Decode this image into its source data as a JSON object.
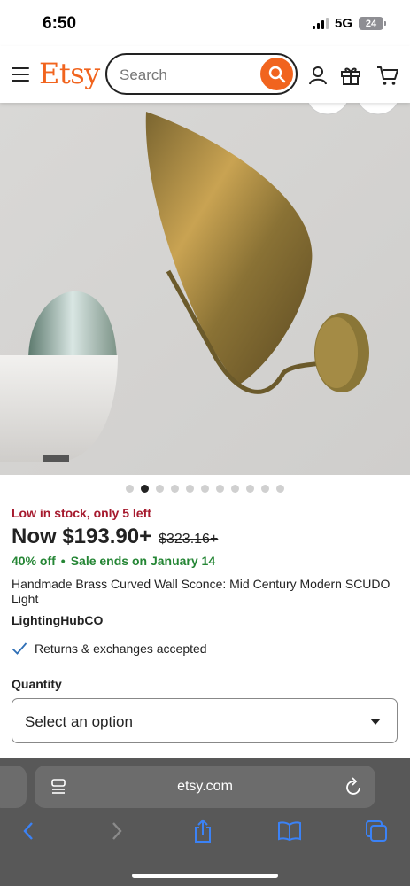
{
  "status": {
    "time": "6:50",
    "network": "5G",
    "battery": "24"
  },
  "header": {
    "logo": "Etsy",
    "search_placeholder": "Search"
  },
  "gallery": {
    "image_count": 11,
    "active_index": 1
  },
  "product": {
    "stock_text": "Low in stock, only 5 left",
    "price_now": "Now $193.90+",
    "price_original": "$323.16+",
    "discount": "40% off",
    "separator": "•",
    "sale_text": "Sale ends on January 14",
    "title": "Handmade Brass Curved Wall Sconce: Mid Century Modern SCUDO Light",
    "shop": "LightingHubCO",
    "returns": "Returns & exchanges accepted",
    "quantity_label": "Quantity",
    "quantity_select_value": "Select an option"
  },
  "browser": {
    "url": "etsy.com"
  },
  "colors": {
    "brand": "#f1641e",
    "stock_red": "#a61a2e",
    "sale_green": "#258635",
    "browser_bg": "#585858",
    "toolbar_icon": "#3b82f6"
  }
}
